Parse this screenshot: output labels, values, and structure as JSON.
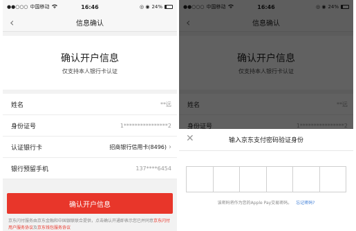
{
  "status_bar": {
    "signal": "●●○○○",
    "carrier": "中国移动",
    "wifi_icon": "wifi-icon",
    "time": "16:46",
    "indicators": "◎ ◉",
    "battery_text": "24%",
    "battery_level": 0.24
  },
  "nav": {
    "back": "‹",
    "title": "信息确认"
  },
  "hero": {
    "title": "确认开户信息",
    "subtitle": "仅支持本人银行卡认证"
  },
  "form": {
    "rows": [
      {
        "label": "姓名",
        "value": "**远"
      },
      {
        "label": "身份证号",
        "value": "1****************2"
      },
      {
        "label": "认证银行卡",
        "value": "招商银行信用卡(8496)",
        "chevron": "›"
      },
      {
        "label": "银行预留手机",
        "value": "137****6454"
      }
    ]
  },
  "submit_label": "确认开户信息",
  "agreement": {
    "text": "京东闪付服务由京东金融和中国银联联合提供，点击确认开通即表示您已并同意",
    "link1": "京东闪付用户服务协议",
    "and": "及",
    "link2": "京东钱包服务协议"
  },
  "sheet": {
    "close": "✕",
    "title": "输入京东支付密码验证身份",
    "pin_cells": 6,
    "note": "该密码将作为您的Apple Pay交易密码。",
    "forgot": "忘记密码?"
  },
  "colors": {
    "accent": "#e8362a",
    "link": "#3a7bd5"
  }
}
